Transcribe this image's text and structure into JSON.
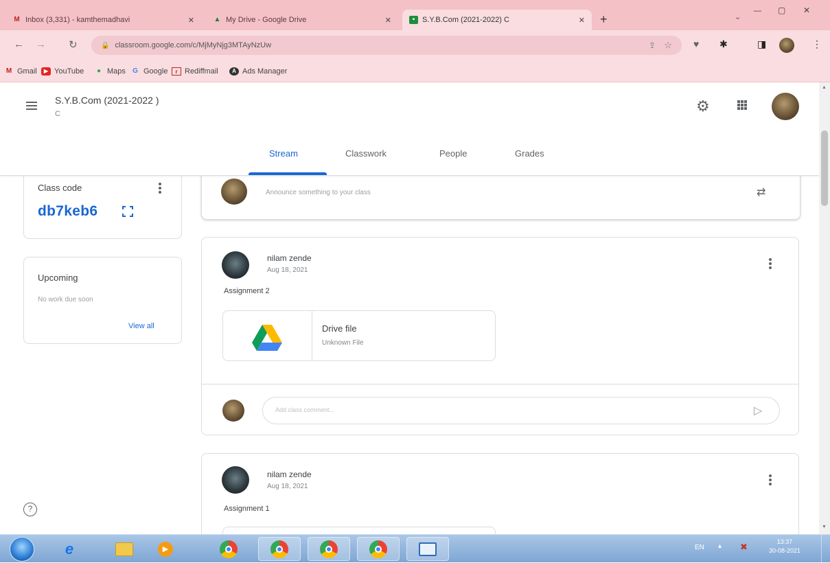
{
  "browser": {
    "tabs": [
      {
        "title": "Inbox (3,331) - kamthemadhavi",
        "icon": "gmail-icon",
        "active": false
      },
      {
        "title": "My Drive - Google Drive",
        "icon": "drive-icon",
        "active": false
      },
      {
        "title": "S.Y.B.Com (2021-2022) C",
        "icon": "classroom-icon",
        "active": true
      }
    ],
    "url": "classroom.google.com/c/MjMyNjg3MTAyNzUw",
    "bookmarks": [
      {
        "label": "Gmail",
        "icon": "gmail-icon"
      },
      {
        "label": "YouTube",
        "icon": "youtube-icon"
      },
      {
        "label": "Maps",
        "icon": "maps-icon"
      },
      {
        "label": "Google",
        "icon": "google-icon"
      },
      {
        "label": "Rediffmail",
        "icon": "rediffmail-icon"
      },
      {
        "label": "Ads Manager",
        "icon": "ads-manager-icon"
      }
    ]
  },
  "classroom": {
    "class_title": "S.Y.B.Com (2021-2022 )",
    "class_subtitle": "C",
    "nav_tabs": [
      "Stream",
      "Classwork",
      "People",
      "Grades"
    ],
    "active_tab": "Stream",
    "class_code_label": "Class code",
    "class_code": "db7keb6",
    "upcoming": {
      "title": "Upcoming",
      "empty_text": "No work due soon",
      "view_all": "View all"
    },
    "announce_placeholder": "Announce something to your class",
    "posts": [
      {
        "author": "nilam zende",
        "date": "Aug 18, 2021",
        "title": "Assignment 2",
        "attachment": {
          "name": "Drive file",
          "type": "Unknown File"
        },
        "comment_placeholder": "Add class comment..."
      },
      {
        "author": "nilam zende",
        "date": "Aug 18, 2021",
        "title": "Assignment 1"
      }
    ]
  },
  "taskbar": {
    "lang": "EN",
    "time": "13:37",
    "date": "30-08-2021"
  },
  "colors": {
    "chrome_frame": "#f4c1c7",
    "accent_blue": "#1967d2",
    "taskbar": "#7ea6d4"
  }
}
